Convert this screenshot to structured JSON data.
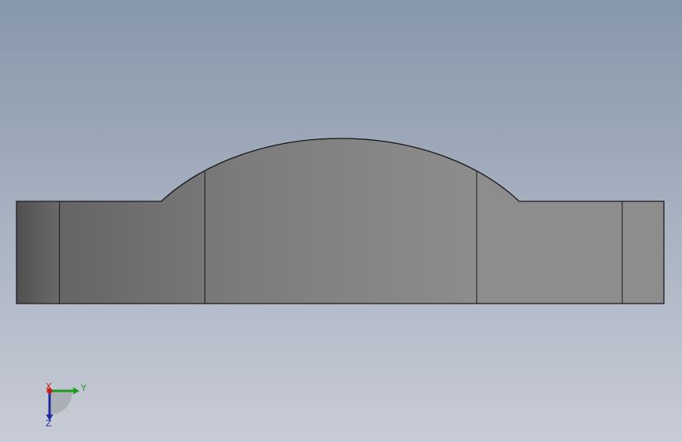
{
  "viewport": {
    "background_top": "#8797ab",
    "background_bottom": "#c8ccd6"
  },
  "part": {
    "face_dark": "#5f5f5f",
    "face_mid": "#7c7c7c",
    "face_light": "#8d8d8d",
    "edge_color": "#1a1a1a"
  },
  "triad": {
    "x_label": "X",
    "y_label": "Y",
    "z_label": "Z",
    "x_color": "#c81e1e",
    "y_color": "#1e9a1e",
    "z_color": "#1e2aa0",
    "icon": "coordinate-triad-icon"
  }
}
